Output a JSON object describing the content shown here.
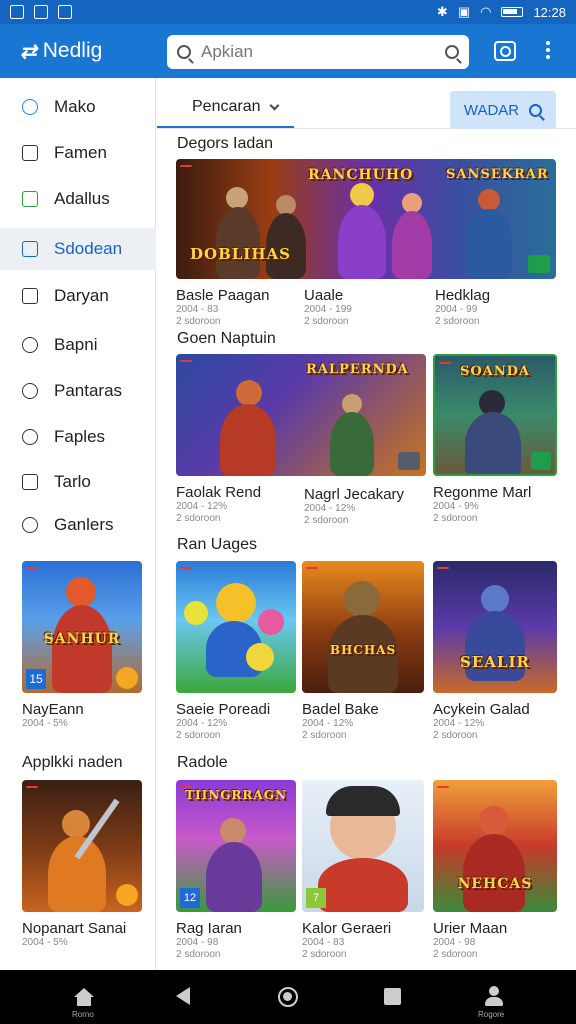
{
  "status_bar": {
    "time": "12:28"
  },
  "app_bar": {
    "title": "Nedlig",
    "search_placeholder": "Apkian"
  },
  "sidebar": {
    "items": [
      {
        "label": "Mako",
        "icon": "person-icon"
      },
      {
        "label": "Famen",
        "icon": "square-icon"
      },
      {
        "label": "Adallus",
        "icon": "calendar-check-icon"
      },
      {
        "label": "Sdodean",
        "icon": "calendar-icon",
        "active": true
      },
      {
        "label": "Daryan",
        "icon": "square-icon"
      },
      {
        "label": "Bapni",
        "icon": "tag-icon"
      },
      {
        "label": "Pantaras",
        "icon": "tag-icon"
      },
      {
        "label": "Faples",
        "icon": "person-icon"
      },
      {
        "label": "Tarlo",
        "icon": "home-icon"
      },
      {
        "label": "Ganlers",
        "icon": "puzzle-icon"
      }
    ],
    "card1": {
      "title": "NayEann",
      "meta": "2004 - 5%",
      "art": "SANHUR"
    },
    "section2": "Applkki naden",
    "card2": {
      "title": "Nopanart Sanai",
      "meta": "2004 - 5%"
    }
  },
  "main": {
    "dropdown_label": "Pencaran",
    "search_button_label": "WADAR",
    "sections": [
      {
        "title": "Degors Iadan",
        "banner_titles": [
          "DOBLIHAS",
          "RANCHUHO",
          "SANSEKRAR"
        ],
        "items": [
          {
            "title": "Basle Paagan",
            "meta1": "2004 - 83",
            "meta2": "2 sdoroon"
          },
          {
            "title": "Uaale",
            "meta1": "2004 - 199",
            "meta2": "2 sdoroon"
          },
          {
            "title": "Hedklag",
            "meta1": "2004 - 99",
            "meta2": "2 sdoroon"
          }
        ]
      },
      {
        "title": "Goen Naptuin",
        "banner_titles": [
          "RALPERNDA",
          "SOANDA"
        ],
        "items": [
          {
            "title": "Faolak Rend",
            "meta1": "2004 - 12%",
            "meta2": "2 sdoroon"
          },
          {
            "title": "Nagrl Jecakary",
            "meta1": "2004 - 12%",
            "meta2": "2 sdoroon"
          },
          {
            "title": "Regonme Marl",
            "meta1": "2004 - 9%",
            "meta2": "2 sdoroon"
          }
        ]
      },
      {
        "title": "Ran Uages",
        "art_titles": [
          "",
          "BHCHAS",
          "SEALIR"
        ],
        "items": [
          {
            "title": "Saeie Poreadi",
            "meta1": "2004 - 12%",
            "meta2": "2 sdoroon"
          },
          {
            "title": "Badel Bake",
            "meta1": "2004 - 12%",
            "meta2": "2 sdoroon"
          },
          {
            "title": "Acykein Galad",
            "meta1": "2004 - 12%",
            "meta2": "2 sdoroon"
          }
        ]
      },
      {
        "title": "Radole",
        "art_titles": [
          "TIINGRRAGN",
          "",
          "NEHCAS"
        ],
        "items": [
          {
            "title": "Rag Iaran",
            "meta1": "2004 - 98",
            "meta2": "2 sdoroon"
          },
          {
            "title": "Kalor Geraeri",
            "meta1": "2004 - 83",
            "meta2": "2 sdoroon"
          },
          {
            "title": "Urier Maan",
            "meta1": "2004 - 98",
            "meta2": "2 sdoroon"
          }
        ]
      }
    ]
  },
  "nav_bar": {
    "home_label": "Rorno",
    "profile_label": "Rogore"
  },
  "colors": {
    "primary": "#1976d2",
    "status_bar": "#1565c0",
    "active_bg": "#eceff4",
    "accent_light": "#cfe3fa"
  }
}
